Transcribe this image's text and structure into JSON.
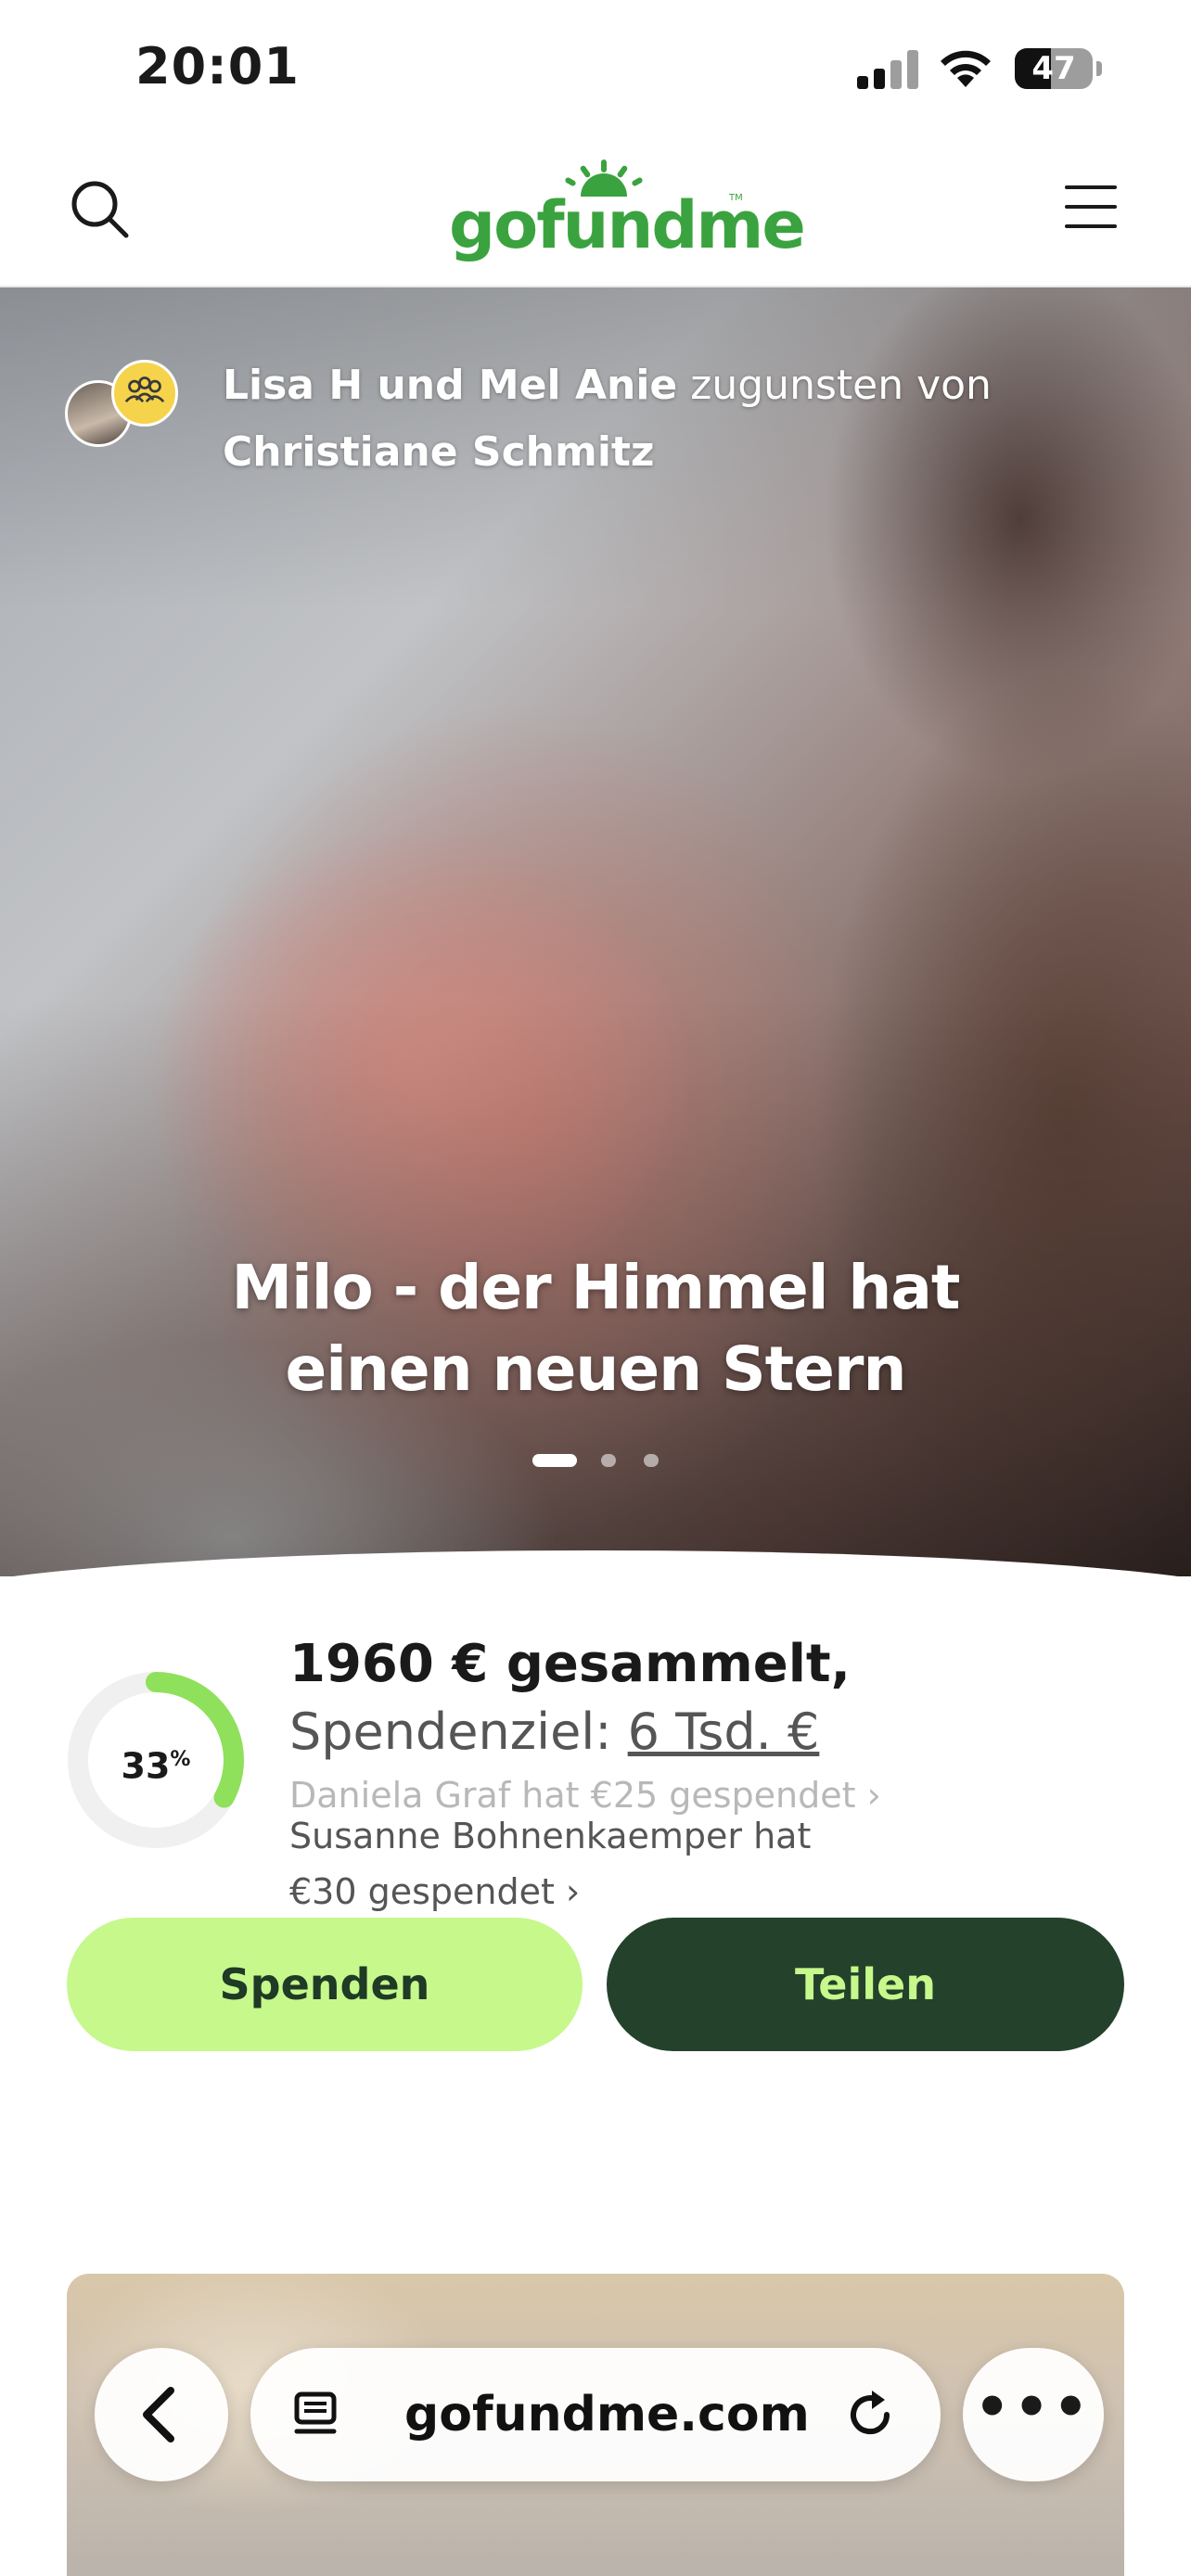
{
  "status_bar": {
    "time": "20:01",
    "battery": "47",
    "battery_level": 0.47
  },
  "header": {
    "logo": "gofundme",
    "search_icon": "search-icon",
    "menu_icon": "hamburger-menu-icon"
  },
  "hero": {
    "organizers": "Lisa H und Mel Anie",
    "on_behalf_of_label": "zugunsten von",
    "beneficiary": "Christiane Schmitz",
    "title": "Milo - der Himmel hat einen neuen Stern",
    "carousel_dots": 3,
    "carousel_active": 0
  },
  "fundraiser": {
    "progress_percent": "33",
    "progress_fraction": 0.33,
    "raised": "1960 € gesammelt,",
    "goal_label": "Spendenziel:",
    "goal_value": "6 Tsd. €",
    "recent_donation_1": "Daniela Graf hat €25 gespendet",
    "recent_donation_2_line1": "Susanne Bohnenkaemper hat",
    "recent_donation_2_line2": "€30 gespendet"
  },
  "actions": {
    "donate_label": "Spenden",
    "share_label": "Teilen"
  },
  "browser": {
    "url": "gofundme.com",
    "more_label": "•••"
  },
  "colors": {
    "brand_green": "#3aa33f",
    "donate_bg": "#c6f88c",
    "share_bg": "#23412b",
    "progress_green": "#8fe05a"
  }
}
